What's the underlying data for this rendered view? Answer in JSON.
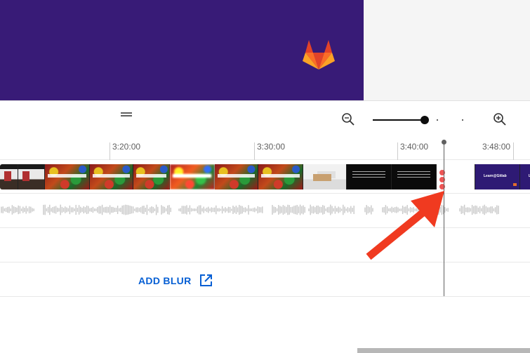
{
  "preview": {
    "logo_icon": "gitlab-fox-icon",
    "background_color": "#381b77"
  },
  "toolbar": {
    "zoom_out_icon": "zoom-out-icon",
    "zoom_in_icon": "zoom-in-icon",
    "zoom_level": 0.5
  },
  "timeline": {
    "ruler_labels": [
      "3:20:00",
      "3:30:00",
      "3:40:00",
      "3:48:00"
    ],
    "video_thumbnail_styles": [
      "t-class",
      "t-class",
      "t-lego",
      "t-lego",
      "t-lego",
      "t-lego blur",
      "t-lego",
      "t-lego",
      "t-box",
      "t-dark",
      "t-dark",
      "t-slide",
      "t-learn",
      "t-learn"
    ],
    "thumbnail_texts": [
      "",
      "",
      "",
      "",
      "",
      "",
      "",
      "",
      "",
      "",
      "",
      "",
      "Learn@Gitlab",
      "Learn@Gitlab"
    ],
    "add_blur_label": "ADD BLUR",
    "add_blur_icon": "open-in-new-icon"
  },
  "annotation": {
    "arrow_color": "#f03a20"
  },
  "colors": {
    "accent_blue": "#065fd4",
    "waveform": "#c8c8c8"
  }
}
